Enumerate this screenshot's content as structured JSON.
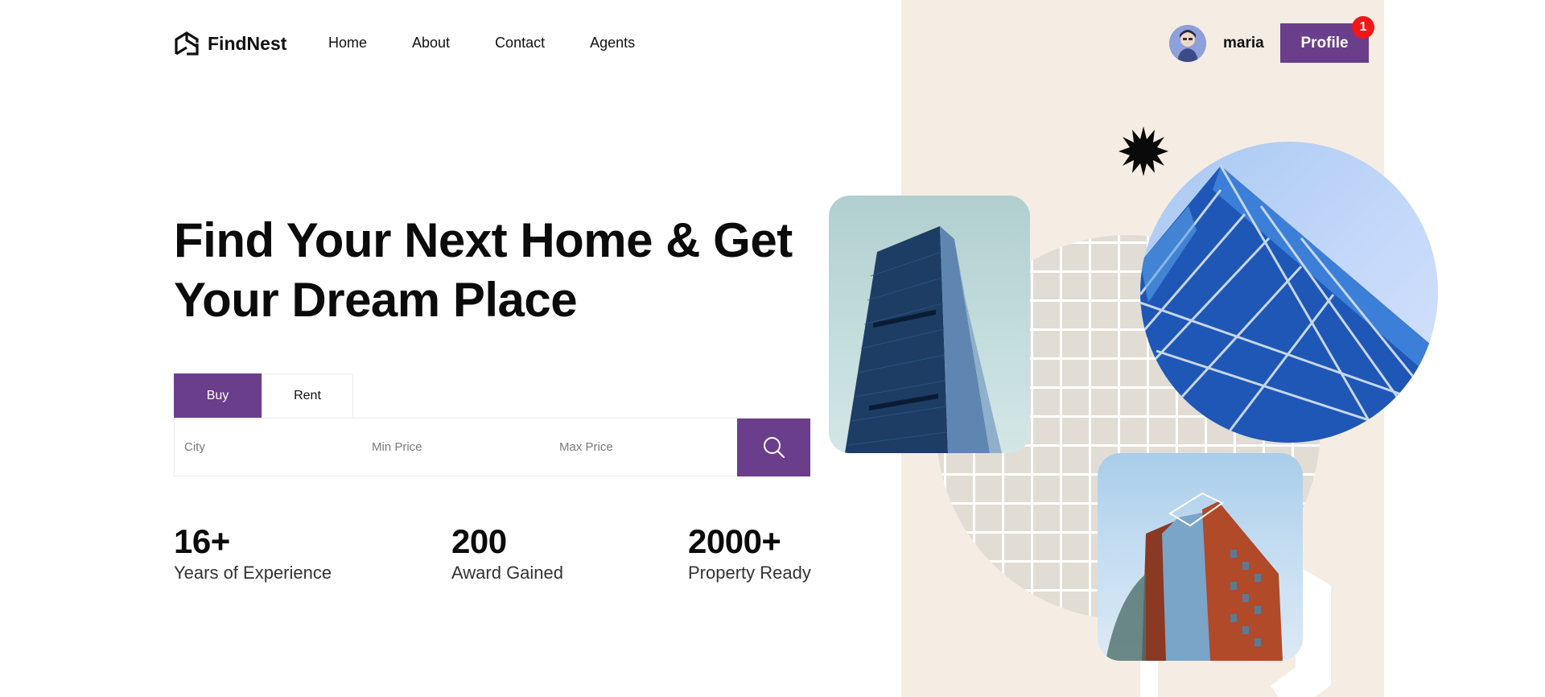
{
  "brand": {
    "name": "FindNest",
    "logo_icon": "findnest-logo-icon"
  },
  "nav": {
    "items": [
      {
        "label": "Home"
      },
      {
        "label": "About"
      },
      {
        "label": "Contact"
      },
      {
        "label": "Agents"
      }
    ]
  },
  "user": {
    "name": "maria",
    "profile_label": "Profile",
    "notification_count": "1"
  },
  "hero": {
    "title_line1": "Find Your Next Home & Get",
    "title_line2": "Your Dream Place"
  },
  "search": {
    "tabs": [
      {
        "label": "Buy",
        "active": true
      },
      {
        "label": "Rent",
        "active": false
      }
    ],
    "city_placeholder": "City",
    "min_price_placeholder": "Min Price",
    "max_price_placeholder": "Max Price",
    "button_icon": "search-icon"
  },
  "stats": [
    {
      "value": "16+",
      "label": "Years of Experience"
    },
    {
      "value": "200",
      "label": "Award Gained"
    },
    {
      "value": "2000+",
      "label": "Property Ready"
    }
  ],
  "colors": {
    "accent": "#6b3e8c",
    "panel": "#f5ede4",
    "badge": "#f01818"
  }
}
